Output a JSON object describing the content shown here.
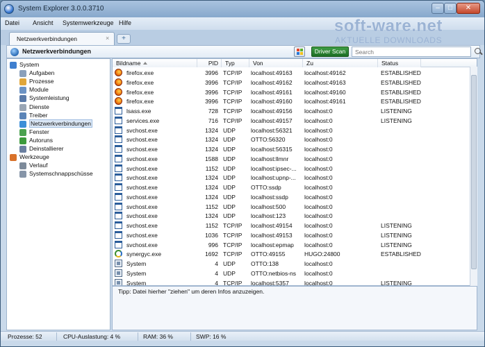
{
  "window": {
    "title": "System Explorer 3.0.0.3710"
  },
  "menu": [
    "Datei",
    "Ansicht",
    "Systemwerkzeuge",
    "Hilfe"
  ],
  "tab": {
    "label": "Netzwerkverbindungen",
    "close": "×",
    "add": "+"
  },
  "logo": {
    "main": "soft-ware.net",
    "sub": "AKTUELLE DOWNLOADS"
  },
  "toolbar": {
    "title": "Netzwerkverbindungen",
    "driver_scan": "Driver Scan",
    "search_placeholder": "Search"
  },
  "sidebar": [
    {
      "label": "System",
      "icon": "computer-icon",
      "level": 0
    },
    {
      "label": "Aufgaben",
      "icon": "tasks-icon",
      "level": 1
    },
    {
      "label": "Prozesse",
      "icon": "processes-icon",
      "level": 1
    },
    {
      "label": "Module",
      "icon": "modules-icon",
      "level": 1
    },
    {
      "label": "Systemleistung",
      "icon": "performance-icon",
      "level": 1
    },
    {
      "label": "Dienste",
      "icon": "services-icon",
      "level": 1
    },
    {
      "label": "Treiber",
      "icon": "drivers-icon",
      "level": 1
    },
    {
      "label": "Netzwerkverbindungen",
      "icon": "network-icon",
      "level": 1,
      "selected": true
    },
    {
      "label": "Fenster",
      "icon": "windows-icon",
      "level": 1
    },
    {
      "label": "Autoruns",
      "icon": "autoruns-icon",
      "level": 1
    },
    {
      "label": "Deinstallierer",
      "icon": "uninstaller-icon",
      "level": 1
    },
    {
      "label": "Werkzeuge",
      "icon": "toolbox-icon",
      "level": 0
    },
    {
      "label": "Verlauf",
      "icon": "history-icon",
      "level": 1
    },
    {
      "label": "Systemschnappschüsse",
      "icon": "snapshots-icon",
      "level": 1
    }
  ],
  "columns": [
    "Bildname",
    "PID",
    "Typ",
    "Von",
    "Zu",
    "Status"
  ],
  "rows": [
    {
      "name": "firefox.exe",
      "icon": "firefox",
      "pid": "3996",
      "type": "TCP/IP",
      "from": "localhost:49163",
      "to": "localhost:49162",
      "status": "ESTABLISHED"
    },
    {
      "name": "firefox.exe",
      "icon": "firefox",
      "pid": "3996",
      "type": "TCP/IP",
      "from": "localhost:49162",
      "to": "localhost:49163",
      "status": "ESTABLISHED"
    },
    {
      "name": "firefox.exe",
      "icon": "firefox",
      "pid": "3996",
      "type": "TCP/IP",
      "from": "localhost:49161",
      "to": "localhost:49160",
      "status": "ESTABLISHED"
    },
    {
      "name": "firefox.exe",
      "icon": "firefox",
      "pid": "3996",
      "type": "TCP/IP",
      "from": "localhost:49160",
      "to": "localhost:49161",
      "status": "ESTABLISHED"
    },
    {
      "name": "lsass.exe",
      "icon": "window",
      "pid": "728",
      "type": "TCP/IP",
      "from": "localhost:49156",
      "to": "localhost:0",
      "status": "LISTENING"
    },
    {
      "name": "services.exe",
      "icon": "window",
      "pid": "716",
      "type": "TCP/IP",
      "from": "localhost:49157",
      "to": "localhost:0",
      "status": "LISTENING"
    },
    {
      "name": "svchost.exe",
      "icon": "window",
      "pid": "1324",
      "type": "UDP",
      "from": "localhost:56321",
      "to": "localhost:0",
      "status": ""
    },
    {
      "name": "svchost.exe",
      "icon": "window",
      "pid": "1324",
      "type": "UDP",
      "from": "OTTO:56320",
      "to": "localhost:0",
      "status": ""
    },
    {
      "name": "svchost.exe",
      "icon": "window",
      "pid": "1324",
      "type": "UDP",
      "from": "localhost:56315",
      "to": "localhost:0",
      "status": ""
    },
    {
      "name": "svchost.exe",
      "icon": "window",
      "pid": "1588",
      "type": "UDP",
      "from": "localhost:llmnr",
      "to": "localhost:0",
      "status": ""
    },
    {
      "name": "svchost.exe",
      "icon": "window",
      "pid": "1152",
      "type": "UDP",
      "from": "localhost:ipsec-...",
      "to": "localhost:0",
      "status": ""
    },
    {
      "name": "svchost.exe",
      "icon": "window",
      "pid": "1324",
      "type": "UDP",
      "from": "localhost:upnp-...",
      "to": "localhost:0",
      "status": ""
    },
    {
      "name": "svchost.exe",
      "icon": "window",
      "pid": "1324",
      "type": "UDP",
      "from": "OTTO:ssdp",
      "to": "localhost:0",
      "status": ""
    },
    {
      "name": "svchost.exe",
      "icon": "window",
      "pid": "1324",
      "type": "UDP",
      "from": "localhost:ssdp",
      "to": "localhost:0",
      "status": ""
    },
    {
      "name": "svchost.exe",
      "icon": "window",
      "pid": "1152",
      "type": "UDP",
      "from": "localhost:500",
      "to": "localhost:0",
      "status": ""
    },
    {
      "name": "svchost.exe",
      "icon": "window",
      "pid": "1324",
      "type": "UDP",
      "from": "localhost:123",
      "to": "localhost:0",
      "status": ""
    },
    {
      "name": "svchost.exe",
      "icon": "window",
      "pid": "1152",
      "type": "TCP/IP",
      "from": "localhost:49154",
      "to": "localhost:0",
      "status": "LISTENING"
    },
    {
      "name": "svchost.exe",
      "icon": "window",
      "pid": "1036",
      "type": "TCP/IP",
      "from": "localhost:49153",
      "to": "localhost:0",
      "status": "LISTENING"
    },
    {
      "name": "svchost.exe",
      "icon": "window",
      "pid": "996",
      "type": "TCP/IP",
      "from": "localhost:epmap",
      "to": "localhost:0",
      "status": "LISTENING"
    },
    {
      "name": "synergyc.exe",
      "icon": "synergy",
      "pid": "1692",
      "type": "TCP/IP",
      "from": "OTTO:49155",
      "to": "HUGO:24800",
      "status": "ESTABLISHED"
    },
    {
      "name": "System",
      "icon": "system",
      "pid": "4",
      "type": "UDP",
      "from": "OTTO:138",
      "to": "localhost:0",
      "status": ""
    },
    {
      "name": "System",
      "icon": "system",
      "pid": "4",
      "type": "UDP",
      "from": "OTTO:netbios-ns",
      "to": "localhost:0",
      "status": ""
    },
    {
      "name": "System",
      "icon": "system",
      "pid": "4",
      "type": "TCP/IP",
      "from": "localhost:5357",
      "to": "localhost:0",
      "status": "LISTENING"
    }
  ],
  "hint": "Tipp: Datei hierher \"ziehen\" um deren Infos anzuzeigen.",
  "status": {
    "processes": "Prozesse: 52",
    "cpu": "CPU-Auslastung: 4 %",
    "ram": "RAM: 36 %",
    "swp": "SWP: 16 %"
  }
}
